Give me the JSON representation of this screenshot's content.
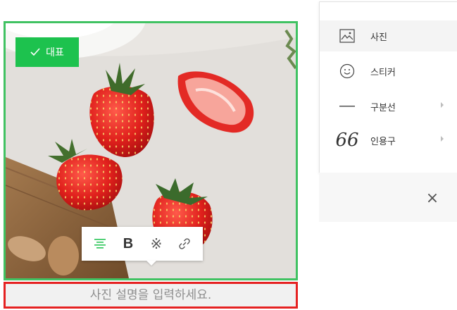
{
  "photo_block": {
    "badge_label": "대표",
    "caption_placeholder": "사진 설명을 입력하세요.",
    "caption_value": ""
  },
  "format_toolbar": {
    "buttons": [
      {
        "name": "align",
        "icon": "align-center-icon"
      },
      {
        "name": "bold",
        "label": "B",
        "icon": "bold-icon"
      },
      {
        "name": "effect",
        "label": "※",
        "icon": "effect-icon"
      },
      {
        "name": "link",
        "icon": "link-icon"
      }
    ]
  },
  "insert_menu": {
    "items": [
      {
        "label": "사진",
        "icon": "image-icon",
        "active": true,
        "submenu": false
      },
      {
        "label": "스티커",
        "icon": "smiley-icon",
        "active": false,
        "submenu": false
      },
      {
        "label": "구분선",
        "icon": "horizontal-line-icon",
        "active": false,
        "submenu": true
      },
      {
        "label": "인용구",
        "icon": "quote-icon",
        "glyph": "66",
        "active": false,
        "submenu": true
      }
    ],
    "close_glyph": "×"
  },
  "colors": {
    "frame_border": "#40c262",
    "badge_bg": "#1dc24e",
    "caption_border": "#e52222",
    "align_icon": "#1dc24e"
  }
}
